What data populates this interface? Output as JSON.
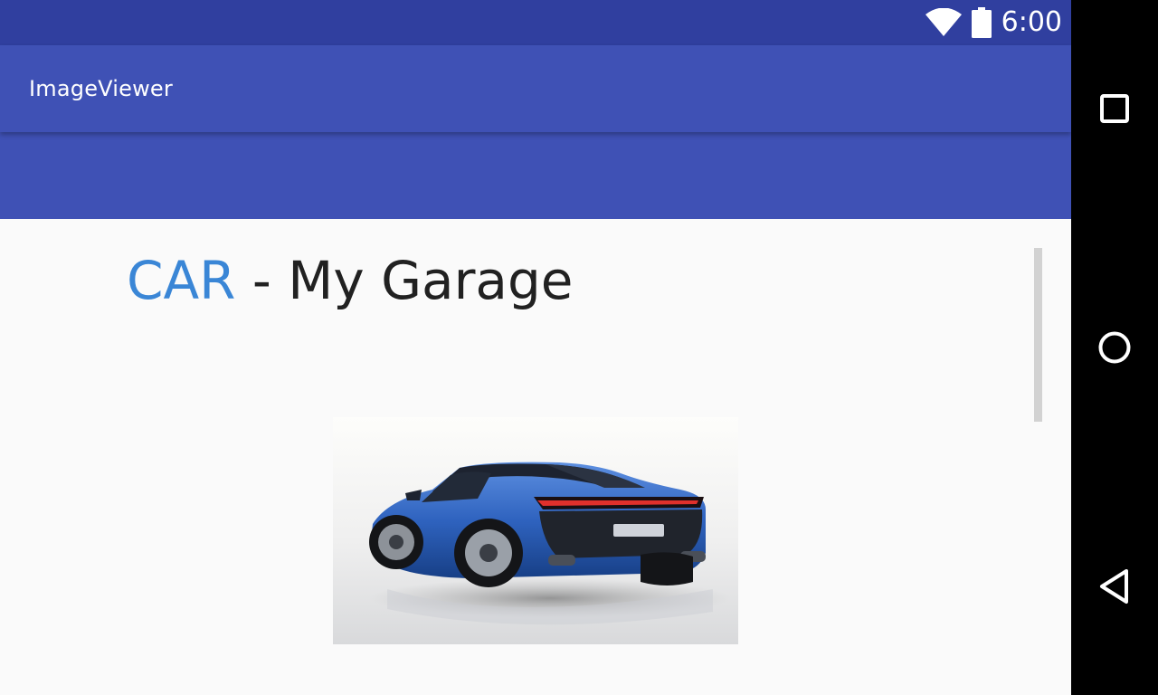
{
  "status_bar": {
    "time": "6:00",
    "icons": [
      "wifi-icon",
      "battery-icon"
    ],
    "color": "#303f9f"
  },
  "app_bar": {
    "title": "ImageViewer",
    "color": "#3f51b5"
  },
  "content": {
    "heading_accent": "CAR",
    "heading_rest": " - My Garage",
    "accent_color": "#3a86d6",
    "image_subject": "blue sports car, rear three-quarter view"
  },
  "nav_bar": {
    "buttons": [
      "recents-square-icon",
      "home-circle-icon",
      "back-triangle-icon"
    ]
  }
}
